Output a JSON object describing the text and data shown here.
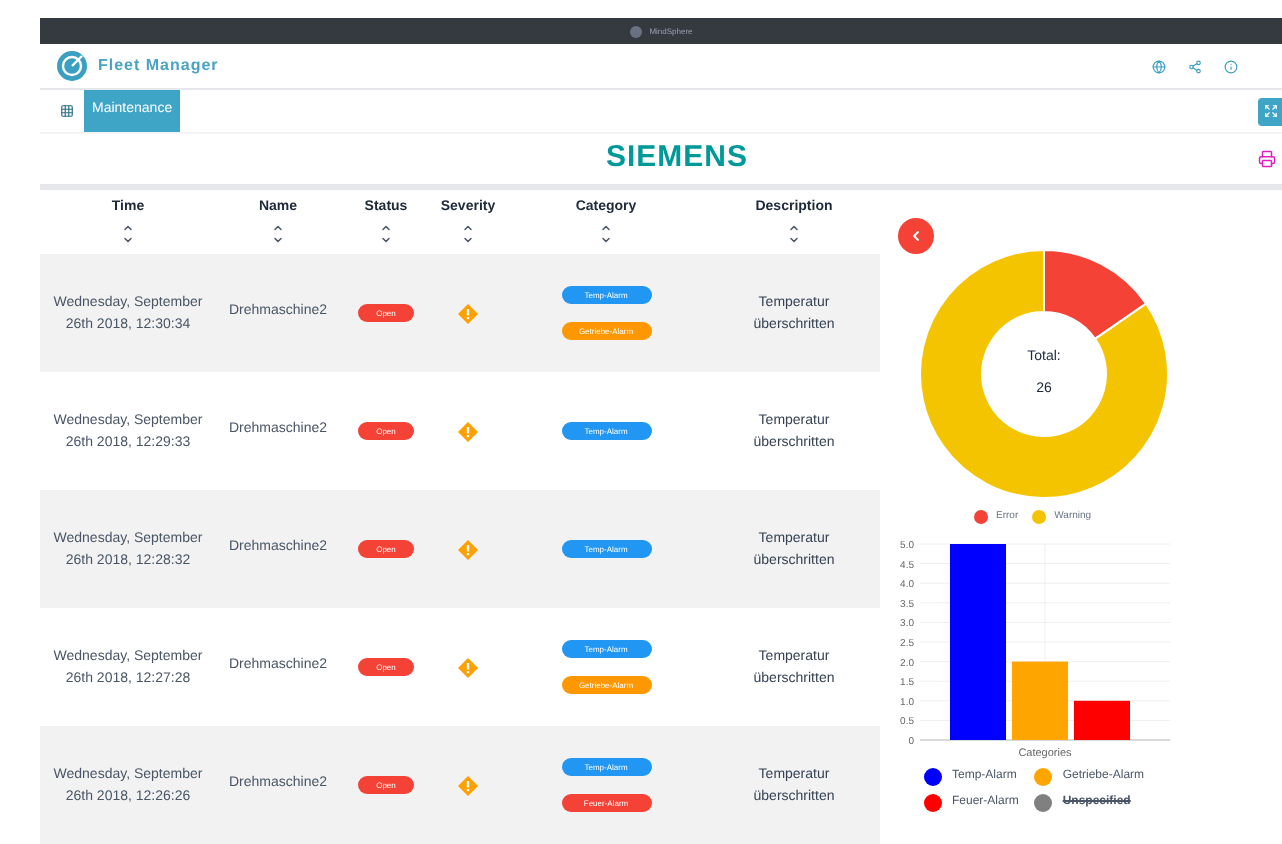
{
  "top_bar": {
    "brand": "MindSphere"
  },
  "header": {
    "app_title": "Fleet Manager"
  },
  "nav": {
    "tabs": [
      {
        "label": "Maintenance",
        "selected": true
      }
    ]
  },
  "banner": {
    "logo_text": "SIEMENS"
  },
  "table": {
    "columns": [
      "Time",
      "Name",
      "Status",
      "Severity",
      "Category",
      "Description"
    ],
    "rows": [
      {
        "time": "Wednesday, September 26th 2018, 12:30:34",
        "name": "Drehmaschine2",
        "status": "Open",
        "categories": [
          {
            "label": "Temp-Alarm",
            "color": "#2196f3"
          },
          {
            "label": "Getriebe-Alarm",
            "color": "#ff9800"
          }
        ],
        "description": "Temperatur überschritten"
      },
      {
        "time": "Wednesday, September 26th 2018, 12:29:33",
        "name": "Drehmaschine2",
        "status": "Open",
        "categories": [
          {
            "label": "Temp-Alarm",
            "color": "#2196f3"
          }
        ],
        "description": "Temperatur überschritten"
      },
      {
        "time": "Wednesday, September 26th 2018, 12:28:32",
        "name": "Drehmaschine2",
        "status": "Open",
        "categories": [
          {
            "label": "Temp-Alarm",
            "color": "#2196f3"
          }
        ],
        "description": "Temperatur überschritten"
      },
      {
        "time": "Wednesday, September 26th 2018, 12:27:28",
        "name": "Drehmaschine2",
        "status": "Open",
        "categories": [
          {
            "label": "Temp-Alarm",
            "color": "#2196f3"
          },
          {
            "label": "Getriebe-Alarm",
            "color": "#ff9800"
          }
        ],
        "description": "Temperatur überschritten"
      },
      {
        "time": "Wednesday, September 26th 2018, 12:26:26",
        "name": "Drehmaschine2",
        "status": "Open",
        "categories": [
          {
            "label": "Temp-Alarm",
            "color": "#2196f3"
          },
          {
            "label": "Feuer-Alarm",
            "color": "#f44336"
          }
        ],
        "description": "Temperatur überschritten"
      }
    ]
  },
  "donut": {
    "total_label": "Total:",
    "total_value": "26",
    "legend": [
      {
        "label": "Error",
        "color": "#f44336"
      },
      {
        "label": "Warning",
        "color": "#f5c400"
      }
    ]
  },
  "bar_chart": {
    "chart_data": {
      "type": "bar",
      "xlabel": "Categories",
      "grid": true,
      "series": [
        {
          "name": "Temp-Alarm",
          "color": "#0000ff",
          "values": [
            5
          ]
        },
        {
          "name": "Getriebe-Alarm",
          "color": "#ffa500",
          "values": [
            2
          ]
        },
        {
          "name": "Feuer-Alarm",
          "color": "#ff0000",
          "values": [
            1
          ]
        }
      ],
      "ylim": [
        0,
        5
      ],
      "yticks": [
        {
          "value": 0,
          "label": "0"
        },
        {
          "value": 0.5,
          "label": "0.5"
        },
        {
          "value": 1,
          "label": "1.0"
        },
        {
          "value": 1.5,
          "label": "1.5"
        },
        {
          "value": 2,
          "label": "2.0"
        },
        {
          "value": 2.5,
          "label": "2.5"
        },
        {
          "value": 3,
          "label": "3.0"
        },
        {
          "value": 3.5,
          "label": "3.5"
        },
        {
          "value": 4,
          "label": "4.0"
        },
        {
          "value": 4.5,
          "label": "4.5"
        },
        {
          "value": 5,
          "label": "5.0"
        }
      ]
    },
    "extra_legend": [
      {
        "label": "Unspecified",
        "color": "#808080",
        "hidden": true
      }
    ]
  }
}
